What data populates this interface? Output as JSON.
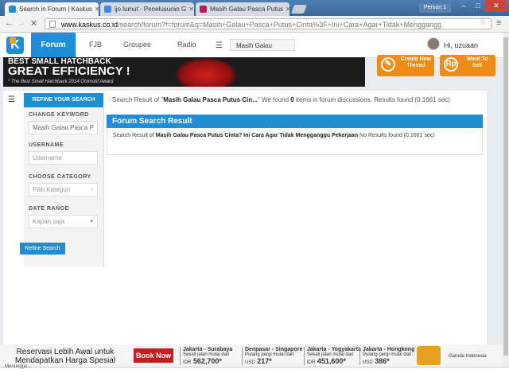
{
  "browser": {
    "tabs": [
      {
        "title": "Search in Forum | Kaskus",
        "color": "#1e8fd6",
        "active": true
      },
      {
        "title": "ijo lumut - Penelusuran G",
        "color": "#4285f4",
        "active": false
      },
      {
        "title": "Masih Galau Pasca Putus",
        "color": "#c2185b",
        "active": false
      }
    ],
    "person_label": "Person 1",
    "url_host": "www.kaskus.co.id",
    "url_path": "/search/forum?f=forum&q=Masih+Galau+Pasca+Putus+Cinta%3F+Ini+Cara+Agar+Tidak+Menggangg",
    "status_text": "Menunggu..."
  },
  "site": {
    "logo": "K",
    "nav": {
      "forum": "Forum",
      "fjb": "FJB",
      "groupee": "Groupee",
      "radio": "Radio"
    },
    "search_value": "Masih Galau",
    "user_greeting": "Hi, uzuaan",
    "create_thread_label": "Create New Thread",
    "want_to_sell_label": "Want To Sell"
  },
  "banner": {
    "line1": "BEST SMALL HATCHBACK",
    "line2": "GREAT EFFICIENCY !",
    "line3": "* The Best Small Hatchback 2014 Otomotif Award"
  },
  "search": {
    "refine_title": "REFINE YOUR SEARCH",
    "result_prefix": "Search Result of \"",
    "result_query": "Masih Galau Pasca Putus Cin...",
    "result_mid": "\" We found ",
    "result_count": "0",
    "result_suffix": " items in forum discussions. Results found (0.1661 sec)",
    "sidebar": {
      "keyword_label": "CHANGE KEYWORD",
      "keyword_value": "Masih Galau Pasca P",
      "username_label": "USERNAME",
      "username_placeholder": "Username",
      "category_label": "CHOOSE CATEGORY",
      "category_value": "Pilih Kategori",
      "date_label": "DATE RANGE",
      "date_value": "Kapan saja",
      "refine_button": "Refine Search"
    },
    "forum_result_title": "Forum Search Result",
    "forum_result_prefix": "Search Result of ",
    "forum_result_query": "Masih Galau Pasca Putus Cinta? Ini Cara Agar Tidak Mengganggu Pekerjaan",
    "forum_result_suffix": " No Results found (0.1661 sec)"
  },
  "ad": {
    "headline": "Reservasi Lebih Awal untuk Mendapatkan Harga Spesial",
    "book_button": "Book Now",
    "offers": [
      {
        "route": "Jakarta - Surabaya",
        "note": "Sekali jalan mulai dari",
        "currency": "IDR",
        "price": "562,700*"
      },
      {
        "route": "Denpasar - Singapore",
        "note": "Pulang pergi mulai dari",
        "currency": "USD",
        "price": "217*"
      },
      {
        "route": "Jakarta - Yogyakarta",
        "note": "Sekali jalan mulai dari",
        "currency": "IDR",
        "price": "451,600*"
      },
      {
        "route": "Jakarta - Hongkong",
        "note": "Pulang pergi mulai dari",
        "currency": "USD",
        "price": "386*"
      }
    ],
    "brand": "Garuda Indonesia"
  }
}
